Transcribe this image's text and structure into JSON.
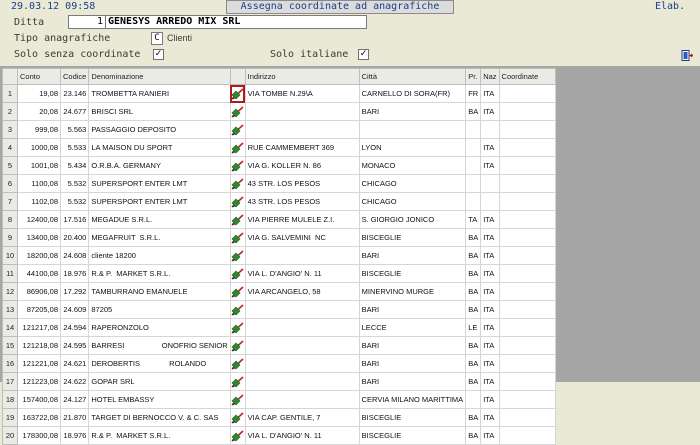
{
  "header": {
    "datetime": "29.03.12 09:58",
    "title": "Assegna coordinate ad anagrafiche",
    "elab": "Elab."
  },
  "form": {
    "ditta_label": "Ditta",
    "ditta_code": "1",
    "ditta_name": "GENESYS ARREDO MIX SRL",
    "tipo_label": "Tipo anagrafiche",
    "tipo_code": "C",
    "tipo_desc": "Clienti",
    "solo_senza_label": "Solo senza coordinate",
    "solo_senza_checked": "✓",
    "solo_italiane_label": "Solo italiane",
    "solo_italiane_checked": "✓"
  },
  "table": {
    "columns": [
      "",
      "Conto",
      "Codice",
      "Denominazione",
      "",
      "Indirizzo",
      "Città",
      "Pr.",
      "Naz",
      "Coordinate"
    ],
    "rows": [
      {
        "n": "1",
        "conto": "19,08",
        "codice": "23.146",
        "denominazione": "TROMBETTA RANIERI",
        "indirizzo": "VIA TOMBE N.29\\A",
        "citta": "CARNELLO DI SORA(FR)",
        "pr": "FR",
        "naz": "ITA",
        "coord": ""
      },
      {
        "n": "2",
        "conto": "20,08",
        "codice": "24.677",
        "denominazione": "BRISCI SRL",
        "indirizzo": "",
        "citta": "BARI",
        "pr": "BA",
        "naz": "ITA",
        "coord": ""
      },
      {
        "n": "3",
        "conto": "999,08",
        "codice": "5.563",
        "denominazione": "PASSAGGIO DEPOSITO",
        "indirizzo": "",
        "citta": "",
        "pr": "",
        "naz": "",
        "coord": ""
      },
      {
        "n": "4",
        "conto": "1000,08",
        "codice": "5.533",
        "denominazione": "LA MAISON DU SPORT",
        "indirizzo": "RUE CAMMEMBERT 369",
        "citta": "LYON",
        "pr": "",
        "naz": "ITA",
        "coord": ""
      },
      {
        "n": "5",
        "conto": "1001,08",
        "codice": "5.434",
        "denominazione": "O.R.B.A. GERMANY",
        "indirizzo": "VIA G. KOLLER N. 86",
        "citta": "MONACO",
        "pr": "",
        "naz": "ITA",
        "coord": ""
      },
      {
        "n": "6",
        "conto": "1100,08",
        "codice": "5.532",
        "denominazione": "SUPERSPORT ENTER LMT",
        "indirizzo": "43 STR. LOS PESOS",
        "citta": "CHICAGO",
        "pr": "",
        "naz": "",
        "coord": ""
      },
      {
        "n": "7",
        "conto": "1102,08",
        "codice": "5.532",
        "denominazione": "SUPERSPORT ENTER LMT",
        "indirizzo": "43 STR. LOS PESOS",
        "citta": "CHICAGO",
        "pr": "",
        "naz": "",
        "coord": ""
      },
      {
        "n": "8",
        "conto": "12400,08",
        "codice": "17.516",
        "denominazione": "MEGADUE S.R.L.",
        "indirizzo": "VIA PIERRE MULELE Z.I.",
        "citta": "S. GIORGIO JONICO",
        "pr": "TA",
        "naz": "ITA",
        "coord": ""
      },
      {
        "n": "9",
        "conto": "13400,08",
        "codice": "20.400",
        "denominazione": "MEGAFRUIT  S.R.L.",
        "indirizzo": "VIA G. SALVEMINI  NC",
        "citta": "BISCEGLIE",
        "pr": "BA",
        "naz": "ITA",
        "coord": ""
      },
      {
        "n": "10",
        "conto": "18200,08",
        "codice": "24.608",
        "denominazione": "cliente 18200",
        "indirizzo": "",
        "citta": "BARI",
        "pr": "BA",
        "naz": "ITA",
        "coord": ""
      },
      {
        "n": "11",
        "conto": "44100,08",
        "codice": "18.976",
        "denominazione": "R.& P.  MARKET S.R.L.",
        "indirizzo": "VIA L. D'ANGIO' N. 11",
        "citta": "BISCEGLIE",
        "pr": "BA",
        "naz": "ITA",
        "coord": ""
      },
      {
        "n": "12",
        "conto": "86906,08",
        "codice": "17.292",
        "denominazione": "TAMBURRANO EMANUELE",
        "indirizzo": "VIA ARCANGELO, 58",
        "citta": "MINERVINO MURGE",
        "pr": "BA",
        "naz": "ITA",
        "coord": ""
      },
      {
        "n": "13",
        "conto": "87205,08",
        "codice": "24.609",
        "denominazione": "87205",
        "indirizzo": "",
        "citta": "BARI",
        "pr": "BA",
        "naz": "ITA",
        "coord": ""
      },
      {
        "n": "14",
        "conto": "121217,08",
        "codice": "24.594",
        "denominazione": "RAPERONZOLO",
        "indirizzo": "",
        "citta": "LECCE",
        "pr": "LE",
        "naz": "ITA",
        "coord": ""
      },
      {
        "n": "15",
        "conto": "121218,08",
        "codice": "24.595",
        "denominazione": "BARRESI                  ONOFRIO SENIOR",
        "indirizzo": "",
        "citta": "BARI",
        "pr": "BA",
        "naz": "ITA",
        "coord": ""
      },
      {
        "n": "16",
        "conto": "121221,08",
        "codice": "24.621",
        "denominazione": "DEROBERTIS              ROLANDO",
        "indirizzo": "",
        "citta": "BARI",
        "pr": "BA",
        "naz": "ITA",
        "coord": ""
      },
      {
        "n": "17",
        "conto": "121223,08",
        "codice": "24.622",
        "denominazione": "GOPAR SRL",
        "indirizzo": "",
        "citta": "BARI",
        "pr": "BA",
        "naz": "ITA",
        "coord": ""
      },
      {
        "n": "18",
        "conto": "157400,08",
        "codice": "24.127",
        "denominazione": "HOTEL EMBASSY",
        "indirizzo": "",
        "citta": "CERVIA MILANO MARITTIMA",
        "pr": "",
        "naz": "ITA",
        "coord": ""
      },
      {
        "n": "19",
        "conto": "163722,08",
        "codice": "21.870",
        "denominazione": "TARGET DI BERNOCCO V. & C. SAS",
        "indirizzo": "VIA CAP. GENTILE, 7",
        "citta": "BISCEGLIE",
        "pr": "BA",
        "naz": "ITA",
        "coord": ""
      },
      {
        "n": "20",
        "conto": "178300,08",
        "codice": "18.976",
        "denominazione": "R.& P.  MARKET S.R.L.",
        "indirizzo": "VIA L. D'ANGIO' N. 11",
        "citta": "BISCEGLIE",
        "pr": "BA",
        "naz": "ITA",
        "coord": ""
      }
    ]
  },
  "icons": {
    "row_action": "map-pin-edit-icon",
    "exit": "exit-door-icon"
  },
  "colors": {
    "highlight": "#b51818",
    "title_text": "#1a3f8a",
    "background": "#e9e9d6"
  }
}
